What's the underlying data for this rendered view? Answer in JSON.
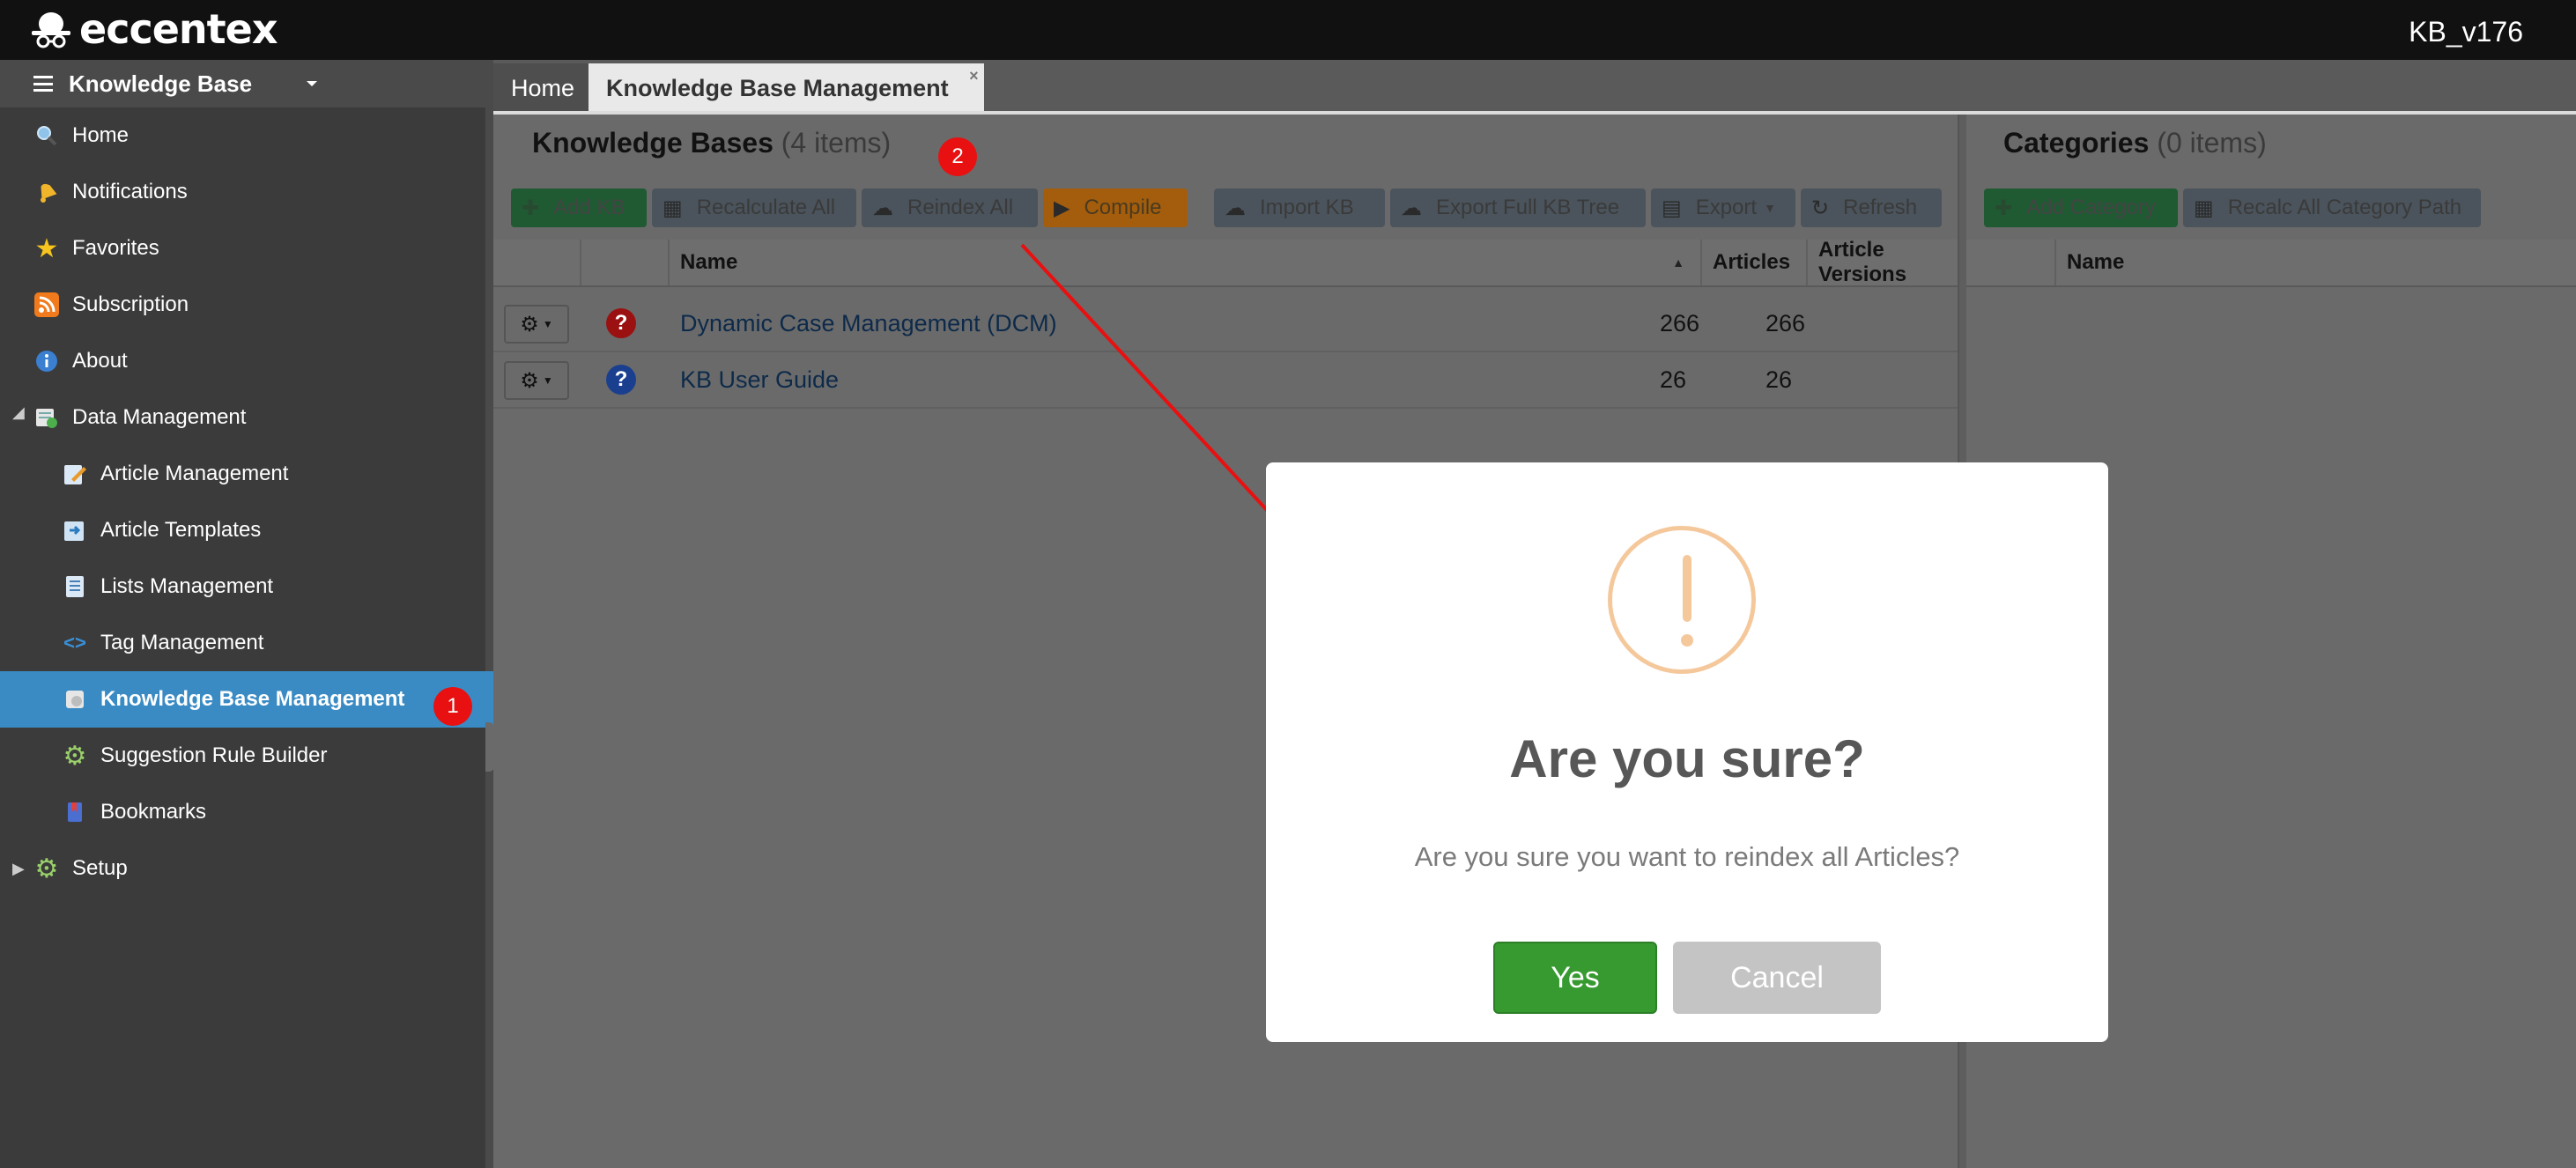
{
  "brand": {
    "name": "eccentex",
    "version": "KB_v176"
  },
  "sidebar": {
    "title": "Knowledge Base",
    "items": [
      {
        "label": "Home",
        "icon": "search-icon"
      },
      {
        "label": "Notifications",
        "icon": "bell-icon"
      },
      {
        "label": "Favorites",
        "icon": "star-icon"
      },
      {
        "label": "Subscription",
        "icon": "rss-icon"
      },
      {
        "label": "About",
        "icon": "info-icon"
      },
      {
        "label": "Data Management",
        "icon": "data-icon"
      },
      {
        "label": "Article Management",
        "icon": "edit-icon"
      },
      {
        "label": "Article Templates",
        "icon": "template-icon"
      },
      {
        "label": "Lists Management",
        "icon": "list-icon"
      },
      {
        "label": "Tag Management",
        "icon": "code-icon"
      },
      {
        "label": "Knowledge Base Management",
        "icon": "kb-icon"
      },
      {
        "label": "Suggestion Rule Builder",
        "icon": "gear-icon"
      },
      {
        "label": "Bookmarks",
        "icon": "bookmark-icon"
      },
      {
        "label": "Setup",
        "icon": "gear-icon"
      }
    ],
    "active": "Knowledge Base Management"
  },
  "annotations": {
    "badge1": "1",
    "badge2": "2"
  },
  "tabs": {
    "home": "Home",
    "active": "Knowledge Base Management",
    "close": "×"
  },
  "kb_panel": {
    "title": "Knowledge Bases",
    "count": "(4 items)",
    "buttons": {
      "add": "Add KB",
      "recalculate": "Recalculate All",
      "reindex": "Reindex All",
      "compile": "Compile",
      "import": "Import KB",
      "export_tree": "Export Full KB Tree",
      "export": "Export",
      "refresh": "Refresh"
    },
    "columns": {
      "name": "Name",
      "articles": "Articles",
      "versions": "Article Versions"
    },
    "rows": [
      {
        "name": "Dynamic Case Management (DCM)",
        "articles": "266",
        "versions": "266",
        "icon_color": "#9b1010"
      },
      {
        "name": "KB User Guide",
        "articles": "26",
        "versions": "26",
        "icon_color": "#1b3f8f"
      }
    ]
  },
  "categories_panel": {
    "title": "Categories",
    "count": "(0 items)",
    "buttons": {
      "add": "Add Category",
      "recalc": "Recalc All Category Path"
    },
    "columns": {
      "name": "Name"
    }
  },
  "dialog": {
    "title": "Are you sure?",
    "text": "Are you sure you want to reindex all Articles?",
    "yes": "Yes",
    "cancel": "Cancel",
    "warn_color": "#f5c89c",
    "yes_color": "#379a30"
  }
}
